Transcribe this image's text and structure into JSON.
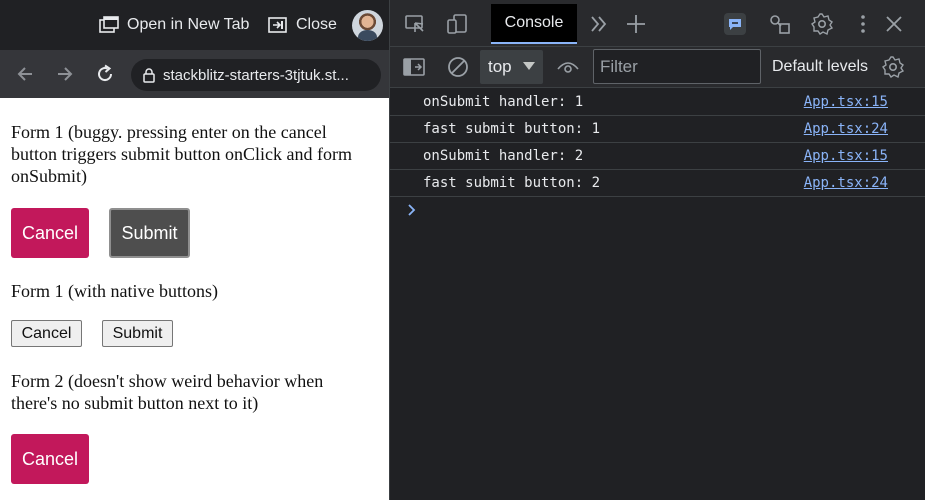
{
  "tabbar": {
    "open_new_tab_label": "Open in New Tab",
    "close_label": "Close"
  },
  "navbar": {
    "url": "stackblitz-starters-3tjtuk.st..."
  },
  "forms": {
    "form1_desc": "Form 1 (buggy. pressing enter on the cancel button triggers submit button onClick and form onSubmit)",
    "form1_cancel": "Cancel",
    "form1_submit": "Submit",
    "form1_native_desc": "Form 1 (with native buttons)",
    "form1_native_cancel": "Cancel",
    "form1_native_submit": "Submit",
    "form2_desc": "Form 2 (doesn't show weird behavior when there's no submit button next to it)",
    "form2_cancel": "Cancel"
  },
  "devtools": {
    "tab_console": "Console",
    "context": "top",
    "filter_placeholder": "Filter",
    "levels": "Default levels",
    "logs": [
      {
        "message": "onSubmit handler: 1",
        "source": "App.tsx:15"
      },
      {
        "message": "fast submit button: 1",
        "source": "App.tsx:24"
      },
      {
        "message": "onSubmit handler: 2",
        "source": "App.tsx:15"
      },
      {
        "message": "fast submit button: 2",
        "source": "App.tsx:24"
      }
    ]
  },
  "colors": {
    "cancel_bg": "#c2185b",
    "submit_bg": "#4e4e4e",
    "link": "#8ab4f8",
    "devtools_bg": "#202124"
  }
}
